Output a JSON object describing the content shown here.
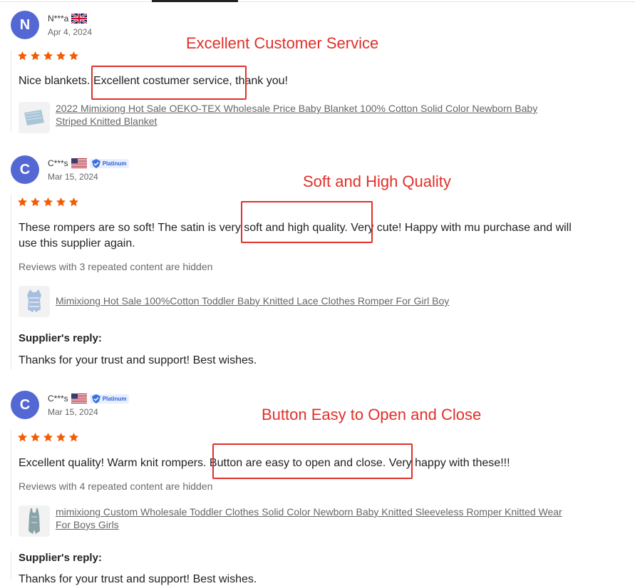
{
  "reviews": [
    {
      "avatar_letter": "N",
      "name": "N***a",
      "flag": "uk-flag",
      "date": "Apr 4, 2024",
      "rating": 5,
      "text": "Nice blankets. Excellent costumer service, thank you!",
      "product_title": "2022 Mimixiong Hot Sale OEKO-TEX Wholesale Price Baby Blanket 100% Cotton Solid Color Newborn Baby Striped Knitted Blanket"
    },
    {
      "avatar_letter": "C",
      "name": "C***s",
      "flag": "us-flag",
      "badge": "Platinum",
      "date": "Mar 15, 2024",
      "rating": 5,
      "text": "These rompers are so soft! The satin is very soft and high quality. Very cute! Happy with mu purchase and will use this supplier again.",
      "hidden_note": "Reviews with 3 repeated content are hidden",
      "product_title": "Mimixiong Hot Sale 100%Cotton Toddler Baby Knitted Lace Clothes Romper For Girl Boy",
      "reply_title": "Supplier's reply:",
      "reply_text": "Thanks for your trust and support! Best wishes."
    },
    {
      "avatar_letter": "C",
      "name": "C***s",
      "flag": "us-flag",
      "badge": "Platinum",
      "date": "Mar 15, 2024",
      "rating": 5,
      "text": "Excellent quality! Warm knit rompers. Button are easy to open and close. Very happy with these!!!",
      "hidden_note": "Reviews with 4 repeated content are hidden",
      "product_title": "mimixiong Custom Wholesale Toddler Clothes Solid Color Newborn Baby Knitted Sleeveless Romper Knitted Wear For Boys Girls",
      "reply_title": "Supplier's reply:",
      "reply_text": "Thanks for your trust and support! Best wishes."
    }
  ],
  "annotations": [
    "Excellent Customer Service",
    "Soft and High Quality",
    "Button Easy to Open and Close"
  ],
  "colors": {
    "avatar": "#5468d4",
    "star": "#f25c05",
    "annotation": "#e0302a"
  }
}
